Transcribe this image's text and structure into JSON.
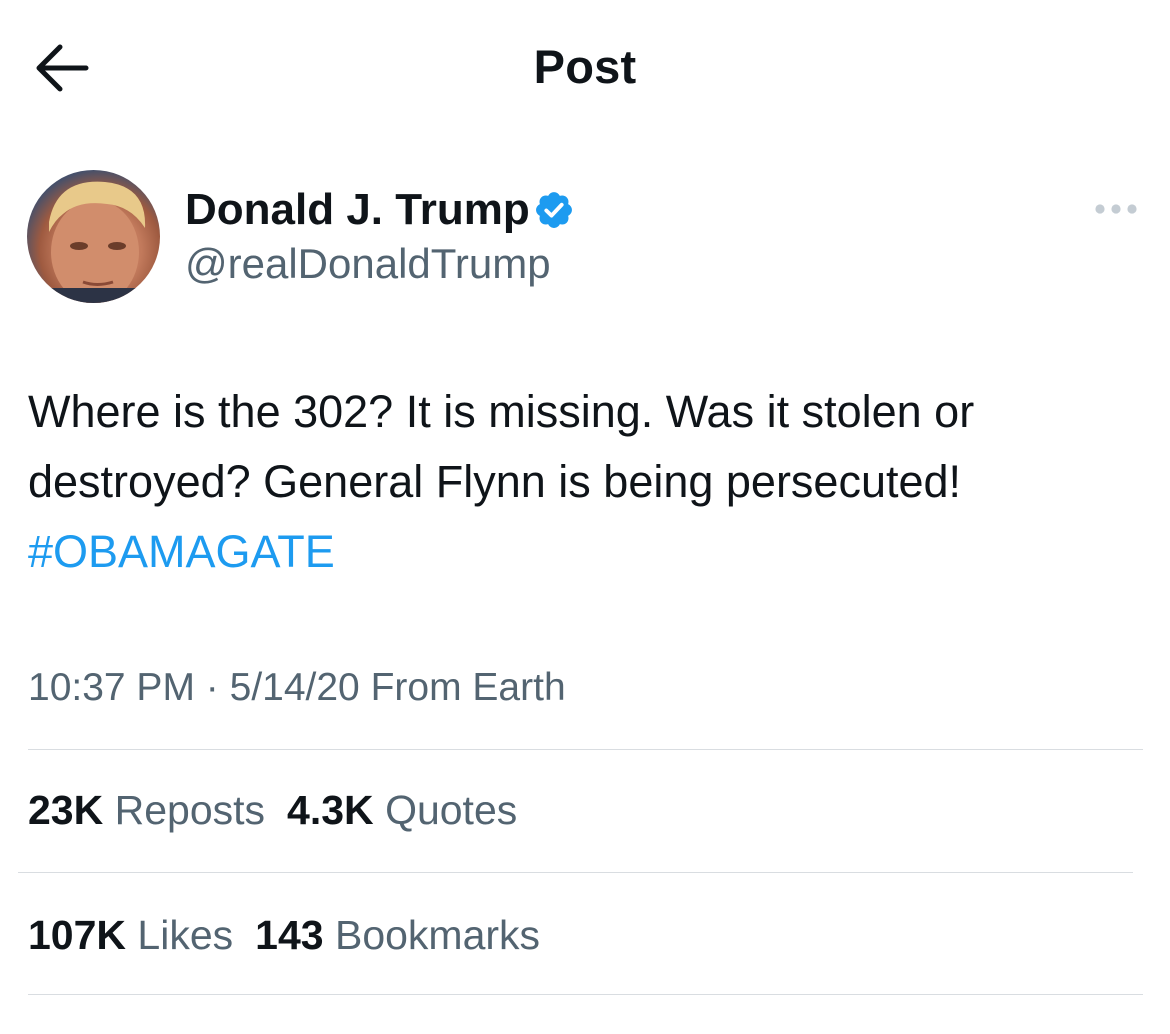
{
  "header": {
    "title": "Post",
    "back_icon": "arrow-left-icon"
  },
  "author": {
    "name": "Donald J. Trump",
    "handle": "@realDonaldTrump",
    "verified_icon": "verified-badge-icon",
    "more_icon": "more-horizontal-icon"
  },
  "tweet": {
    "line1": "Where is the 302? It is missing. Was it stolen or",
    "line2": "destroyed? General Flynn is being persecuted!",
    "hashtag": "#OBAMAGATE"
  },
  "meta": {
    "time": "10:37 PM",
    "separator": "·",
    "date": "5/14/20",
    "location": "From Earth"
  },
  "stats": {
    "reposts": {
      "count": "23K",
      "label": "Reposts"
    },
    "quotes": {
      "count": "4.3K",
      "label": "Quotes"
    },
    "likes": {
      "count": "107K",
      "label": "Likes"
    },
    "bookmarks": {
      "count": "143",
      "label": "Bookmarks"
    }
  },
  "colors": {
    "accent": "#1d9bf0",
    "text_primary": "#0f1419",
    "text_secondary": "#536471",
    "divider": "#d9dde1"
  }
}
